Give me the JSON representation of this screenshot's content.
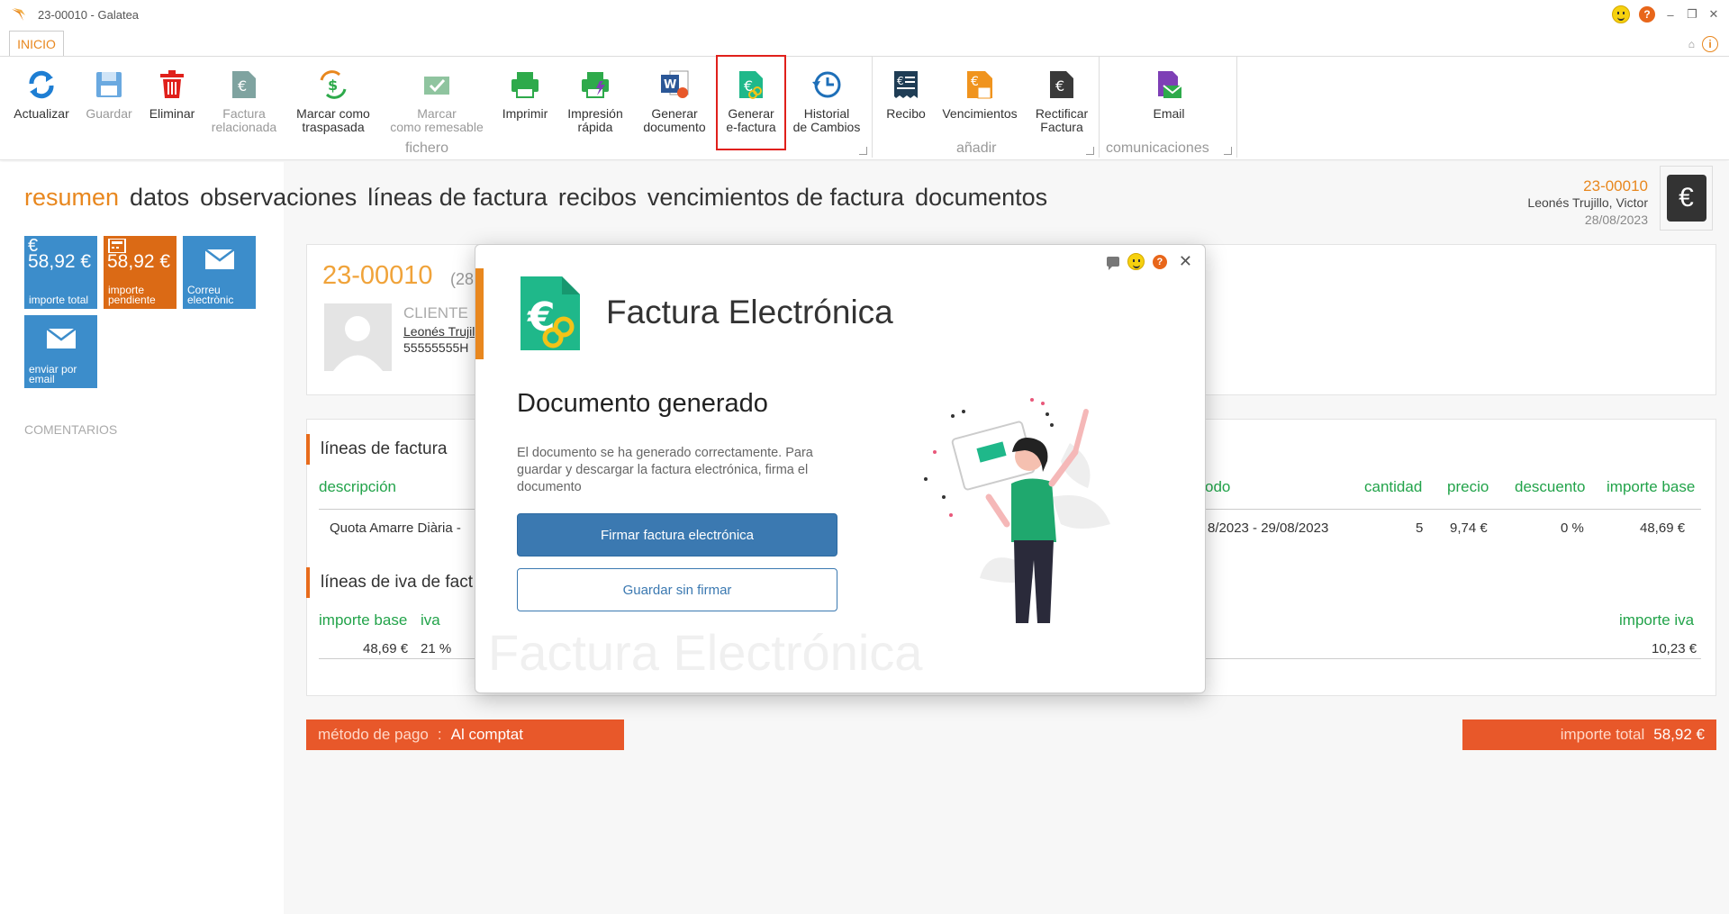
{
  "window": {
    "title": "23-00010 - Galatea"
  },
  "ribbon": {
    "tab_label": "INICIO",
    "buttons": {
      "actualizar": "Actualizar",
      "guardar": "Guardar",
      "eliminar": "Eliminar",
      "factura_relacionada_1": "Factura",
      "factura_relacionada_2": "relacionada",
      "marcar_traspasada_1": "Marcar como",
      "marcar_traspasada_2": "traspasada",
      "marcar_remesable_1": "Marcar",
      "marcar_remesable_2": "como remesable",
      "imprimir": "Imprimir",
      "impresion_rapida_1": "Impresión",
      "impresion_rapida_2": "rápida",
      "generar_documento_1": "Generar",
      "generar_documento_2": "documento",
      "generar_efactura_1": "Generar",
      "generar_efactura_2": "e-factura",
      "historial_1": "Historial",
      "historial_2": "de Cambios",
      "recibo": "Recibo",
      "vencimientos": "Vencimientos",
      "rectificar_1": "Rectificar",
      "rectificar_2": "Factura",
      "email": "Email"
    },
    "groups": {
      "fichero": "fichero",
      "anadir": "añadir",
      "comunicaciones": "comunicaciones"
    }
  },
  "section_tabs": [
    "resumen",
    "datos",
    "observaciones",
    "líneas de factura",
    "recibos",
    "vencimientos de factura",
    "documentos"
  ],
  "doc_summary": {
    "number": "23-00010",
    "client": "Leonés Trujillo, Victor",
    "date": "28/08/2023"
  },
  "tiles": [
    {
      "amount": "58,92 €",
      "label": "importe total",
      "color": "#3c8dcb",
      "icon": "euro-icon"
    },
    {
      "amount": "58,92 €",
      "label": "importe pendiente",
      "color": "#db6a15",
      "icon": "calculator-icon"
    },
    {
      "amount": "",
      "label": "Correu electrònic",
      "color": "#3c8dcb",
      "icon": "envelope-icon"
    },
    {
      "amount": "",
      "label": "enviar por email",
      "color": "#3c8dcb",
      "icon": "envelope-icon"
    }
  ],
  "comentarios_label": "COMENTARIOS",
  "invoice": {
    "number": "23-00010",
    "date_partial": "(28",
    "client_label": "CLIENTE",
    "client_name_partial": "Leonés Trujil",
    "client_id_partial": "55555555H"
  },
  "lines_section": {
    "title": "líneas de factura",
    "columns": {
      "descripcion": "descripción",
      "periodo_partial": "odo",
      "cantidad": "cantidad",
      "precio": "precio",
      "descuento": "descuento",
      "importe_base": "importe base"
    },
    "row": {
      "descripcion": "Quota Amarre Diària -",
      "periodo": "8/2023 - 29/08/2023",
      "cantidad": "5",
      "precio": "9,74 €",
      "descuento": "0 %",
      "importe_base": "48,69 €"
    }
  },
  "iva_section": {
    "title": "líneas de iva de fact",
    "columns": {
      "importe_base": "importe base",
      "iva": "iva",
      "importe_iva": "importe iva"
    },
    "row": {
      "importe_base": "48,69 €",
      "iva": "21 %",
      "importe_iva": "10,23 €"
    }
  },
  "payment": {
    "label": "método de pago",
    "separator": ":",
    "value": "Al comptat"
  },
  "total": {
    "label": "importe total",
    "value": "58,92 €"
  },
  "modal": {
    "title": "Factura Electrónica",
    "subtitle": "Documento generado",
    "description": "El documento se ha generado correctamente. Para guardar y descargar la factura electrónica, firma el documento",
    "primary_button": "Firmar factura electrónica",
    "secondary_button": "Guardar sin firmar",
    "watermark": "Factura Electrónica"
  },
  "colors": {
    "accent_orange": "#e8871e",
    "tile_blue": "#3c8dcb",
    "tile_orange": "#db6a15",
    "bar_red_orange": "#e8582a",
    "green_headers": "#22a34a",
    "button_blue": "#3b79b1",
    "efactura_green": "#1fb88a"
  }
}
